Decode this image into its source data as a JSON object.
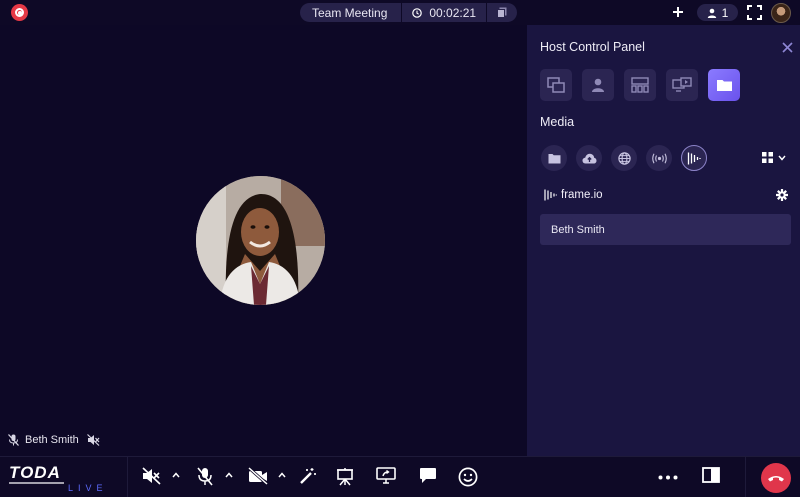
{
  "topbar": {
    "meeting_title": "Team Meeting",
    "timer": "00:02:21",
    "participant_count": "1"
  },
  "stage": {
    "participant_name": "Beth Smith"
  },
  "panel": {
    "title": "Host Control Panel",
    "media_title": "Media",
    "source_name": "frame.io",
    "items": [
      {
        "label": "Beth Smith"
      }
    ]
  },
  "bottombar": {
    "logo_top": "TODA",
    "logo_bottom": "LIVE"
  },
  "colors": {
    "background": "#0e0926",
    "panel": "#1a1540",
    "accent": "#7a67f5",
    "record": "#e53946",
    "hangup": "#e0364b"
  }
}
